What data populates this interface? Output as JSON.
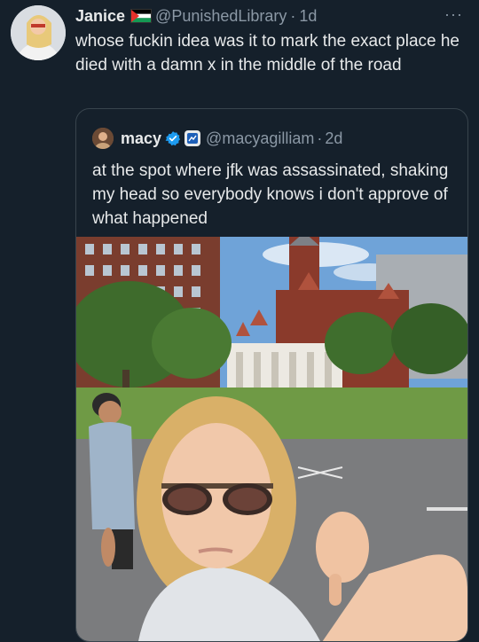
{
  "tweet": {
    "name": "Janice",
    "handle": "@PunishedLibrary",
    "separator": "·",
    "time": "1d",
    "more": "···",
    "text": "whose fuckin idea was it to mark the exact place he died with a damn x in the middle of the road"
  },
  "quote": {
    "name": "macy",
    "handle": "@macyagilliam",
    "separator": "·",
    "time": "2d",
    "text": "at the spot where jfk was assassinated, shaking my head so everybody knows i don't approve of what happened"
  },
  "icons": [
    "palestine-flag-icon",
    "verified-badge-icon",
    "affiliate-badge-icon",
    "more-icon"
  ],
  "colors": {
    "background": "#15202b",
    "text": "#e7e9ea",
    "secondary": "#8b98a5",
    "border": "#38444d",
    "verified": "#1d9bf0"
  }
}
